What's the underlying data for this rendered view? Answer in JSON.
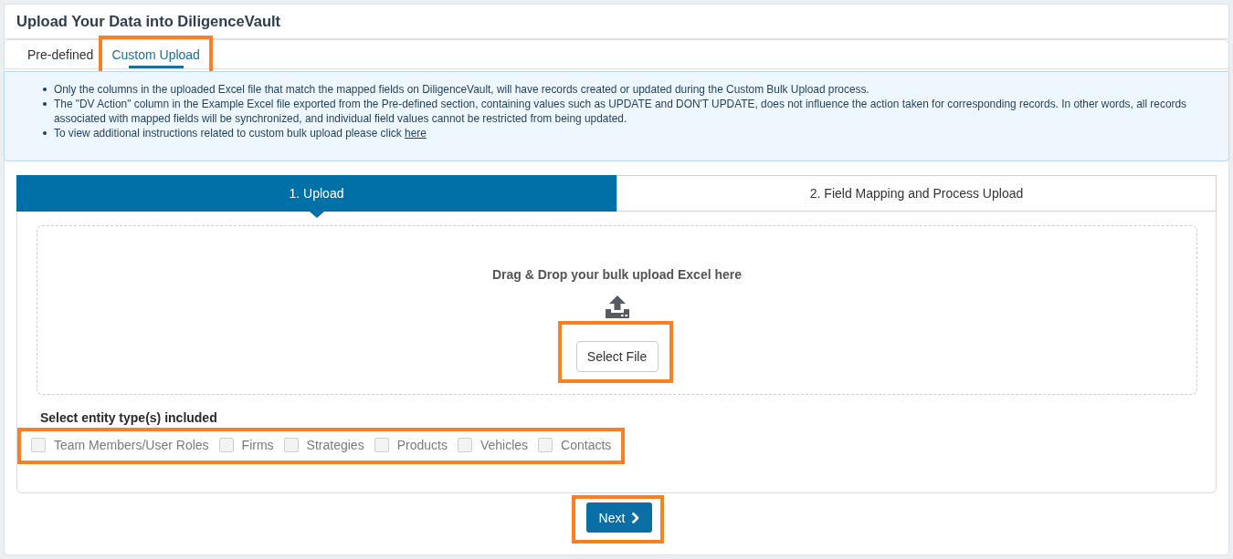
{
  "window": {
    "title": "Upload Your Data into DiligenceVault"
  },
  "tabs": [
    {
      "label": "Pre-defined",
      "selected": false,
      "highlighted": false
    },
    {
      "label": "Custom Upload",
      "selected": true,
      "highlighted": true
    }
  ],
  "info": {
    "bullets": [
      {
        "text": "Only the columns in the uploaded Excel file that match the mapped fields on DiligenceVault, will have records created or updated during the Custom Bulk Upload process."
      },
      {
        "text": "The \"DV Action\" column in the Example Excel file exported from the Pre-defined section, containing values such as UPDATE and DON'T UPDATE, does not influence the action taken for corresponding records. In other words, all records associated with mapped fields will be synchronized, and individual field values cannot be restricted from being updated."
      },
      {
        "text": "To view additional instructions related to custom bulk upload please click",
        "link": "here"
      }
    ]
  },
  "steps": [
    {
      "label": "1. Upload",
      "selected": true
    },
    {
      "label": "2. Field Mapping and Process Upload",
      "selected": false
    }
  ],
  "dropzone": {
    "prompt": "Drag & Drop your bulk upload Excel here",
    "button": {
      "label": "Select File",
      "highlighted": true
    }
  },
  "entity_types": {
    "heading": "Select entity type(s) included",
    "highlighted": true,
    "items": [
      {
        "label": "Team Members/User Roles",
        "checked": false
      },
      {
        "label": "Firms",
        "checked": false
      },
      {
        "label": "Strategies",
        "checked": false
      },
      {
        "label": "Products",
        "checked": false
      },
      {
        "label": "Vehicles",
        "checked": false
      },
      {
        "label": "Contacts",
        "checked": false
      }
    ]
  },
  "next_button": {
    "label": "Next",
    "highlighted": true
  }
}
